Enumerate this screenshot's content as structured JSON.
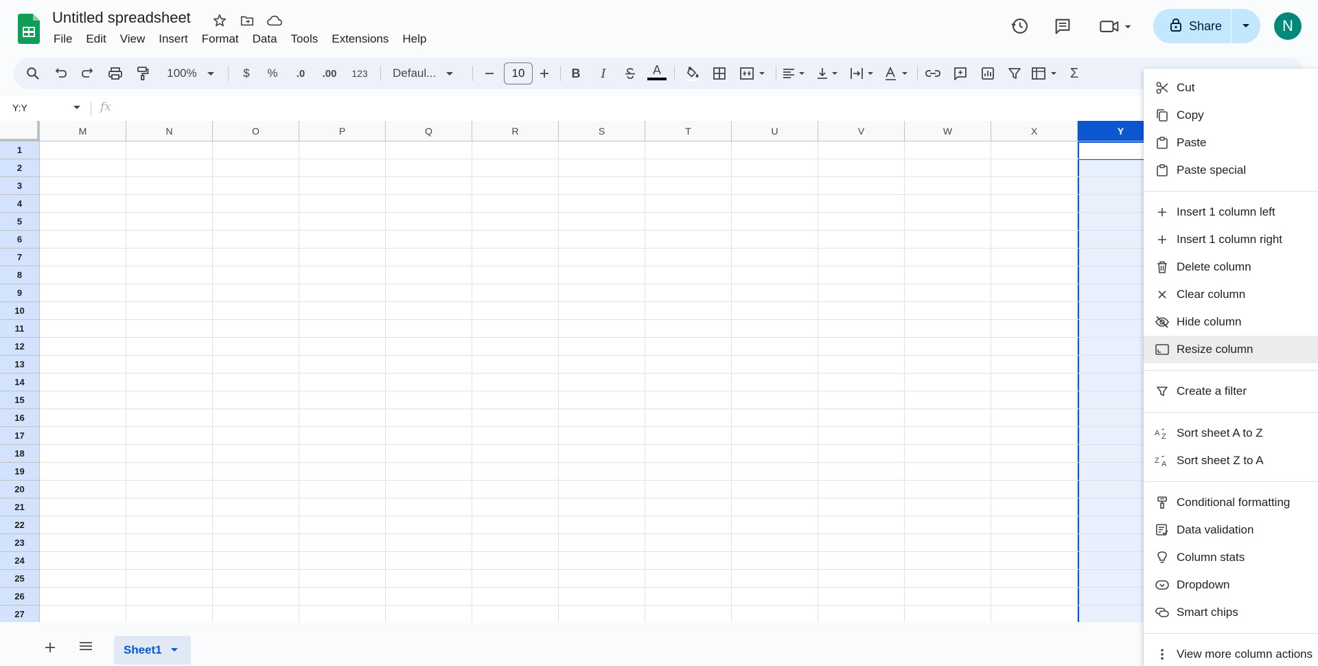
{
  "app": {
    "doc_title": "Untitled spreadsheet",
    "menus": [
      "File",
      "Edit",
      "View",
      "Insert",
      "Format",
      "Data",
      "Tools",
      "Extensions",
      "Help"
    ],
    "share_label": "Share",
    "avatar_letter": "N"
  },
  "toolbar": {
    "zoom": "100%",
    "currency": "$",
    "percent": "%",
    "decrease_decimal": ".0",
    "increase_decimal": ".00",
    "number_format": "123",
    "font": "Defaul...",
    "font_size": "10",
    "bold": "B",
    "italic": "I",
    "text_color": "A",
    "sum": "Σ"
  },
  "formula_bar": {
    "name_box": "Y:Y",
    "fx": "fx"
  },
  "grid": {
    "columns": [
      "M",
      "N",
      "O",
      "P",
      "Q",
      "R",
      "S",
      "T",
      "U",
      "V",
      "W",
      "X",
      "Y"
    ],
    "selected_column": "Y",
    "rows": [
      "1",
      "2",
      "3",
      "4",
      "5",
      "6",
      "7",
      "8",
      "9",
      "10",
      "11",
      "12",
      "13",
      "14",
      "15",
      "16",
      "17",
      "18",
      "19",
      "20",
      "21",
      "22",
      "23",
      "24",
      "25",
      "26",
      "27"
    ]
  },
  "sheets": {
    "active": "Sheet1"
  },
  "context_menu": {
    "groups": [
      [
        {
          "label": "Cut",
          "icon": "scissors-icon"
        },
        {
          "label": "Copy",
          "icon": "copy-icon"
        },
        {
          "label": "Paste",
          "icon": "clipboard-icon"
        },
        {
          "label": "Paste special",
          "icon": "clipboard-icon"
        }
      ],
      [
        {
          "label": "Insert 1 column left",
          "icon": "plus-icon"
        },
        {
          "label": "Insert 1 column right",
          "icon": "plus-icon"
        },
        {
          "label": "Delete column",
          "icon": "trash-icon"
        },
        {
          "label": "Clear column",
          "icon": "close-icon"
        },
        {
          "label": "Hide column",
          "icon": "eye-off-icon"
        },
        {
          "label": "Resize column",
          "icon": "resize-icon",
          "hover": true
        }
      ],
      [
        {
          "label": "Create a filter",
          "icon": "filter-icon"
        }
      ],
      [
        {
          "label": "Sort sheet A to Z",
          "icon": "sort-az-icon"
        },
        {
          "label": "Sort sheet Z to A",
          "icon": "sort-za-icon"
        }
      ],
      [
        {
          "label": "Conditional formatting",
          "icon": "paint-roller-icon"
        },
        {
          "label": "Data validation",
          "icon": "checklist-icon"
        },
        {
          "label": "Column stats",
          "icon": "lightbulb-icon"
        },
        {
          "label": "Dropdown",
          "icon": "dropdown-chip-icon"
        },
        {
          "label": "Smart chips",
          "icon": "smart-chip-icon"
        }
      ],
      [
        {
          "label": "View more column actions",
          "icon": "more-vert-icon"
        }
      ]
    ]
  },
  "colors": {
    "accent": "#0b57d0",
    "selected_column_bg": "#e8f0fe",
    "share_bg": "#c2e7ff",
    "avatar_bg": "#00897b",
    "sheets_green": "#0f9d58"
  }
}
